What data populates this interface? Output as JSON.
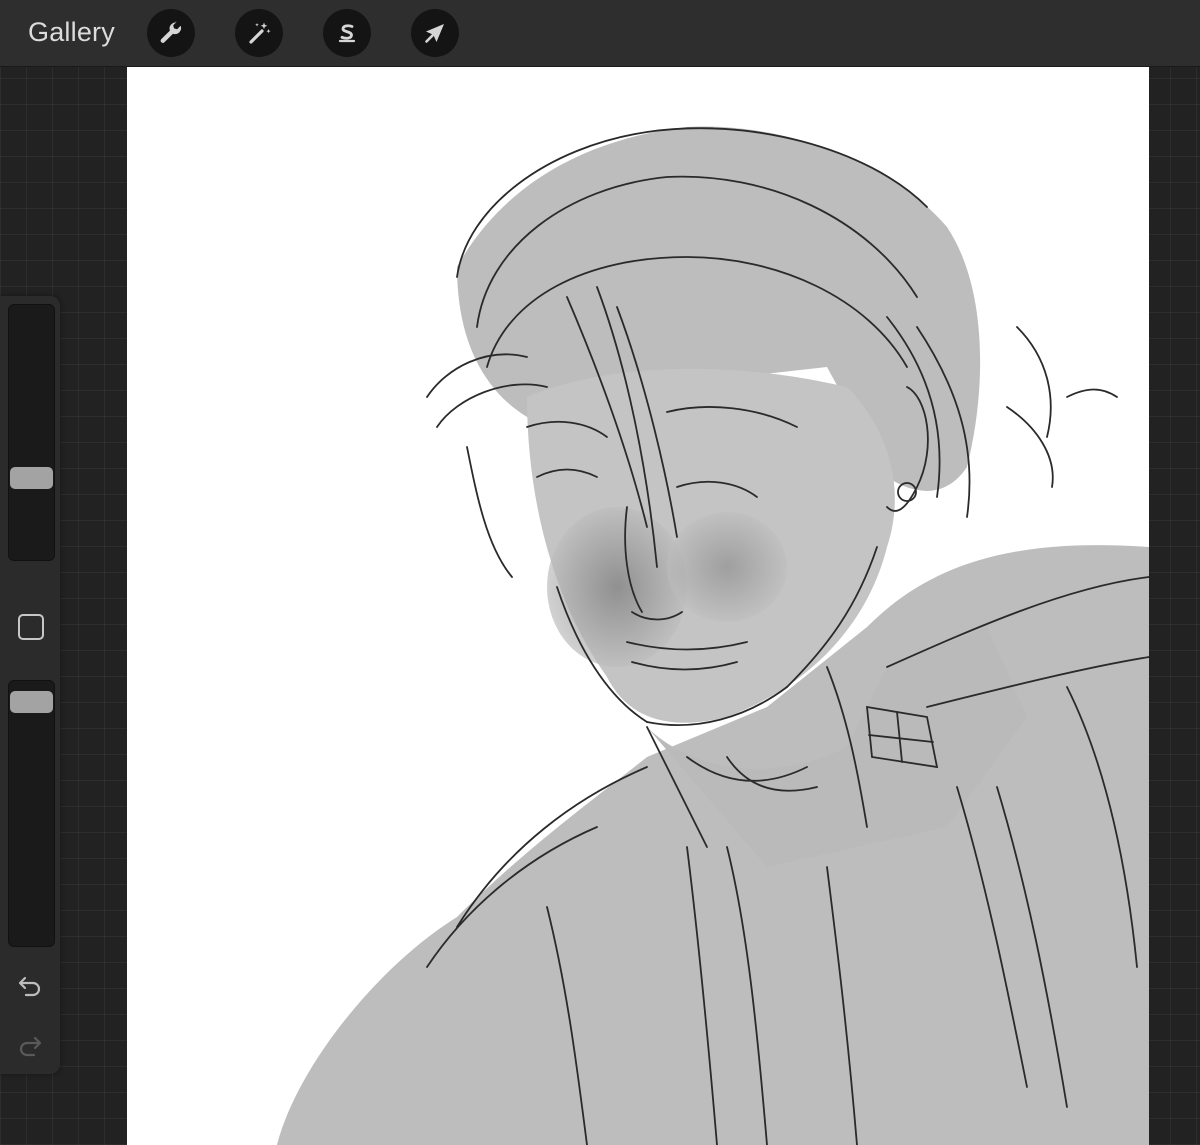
{
  "header": {
    "gallery_label": "Gallery"
  },
  "toolbar": {
    "tools": [
      {
        "name": "actions",
        "icon": "wrench-icon"
      },
      {
        "name": "adjustments",
        "icon": "magic-wand-icon"
      },
      {
        "name": "selection",
        "icon": "selection-s-icon"
      },
      {
        "name": "transform",
        "icon": "arrow-cursor-icon"
      }
    ]
  },
  "sidebar": {
    "brush_size_level": 0.55,
    "brush_opacity_level": 0.95,
    "modify_icon": "square-icon",
    "undo_icon": "undo-icon",
    "redo_icon": "redo-icon"
  },
  "colors": {
    "toolbar_bg": "#2e2e2e",
    "workspace_bg": "#222222",
    "canvas_bg": "#ffffff",
    "fill_gray": "#bdbdbd",
    "line": "#2a2a2a"
  }
}
